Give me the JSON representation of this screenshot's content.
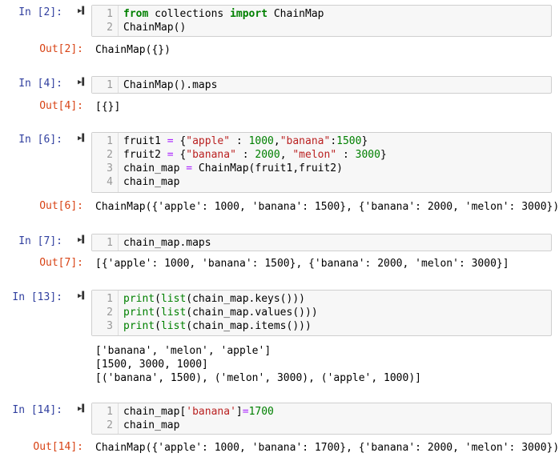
{
  "run_icon": "run-cell-icon",
  "cells": [
    {
      "in_prompt": "In [2]:",
      "lines": [
        [
          {
            "t": "from",
            "c": "kw"
          },
          {
            "t": " collections ",
            "c": ""
          },
          {
            "t": "import",
            "c": "kw"
          },
          {
            "t": " ChainMap",
            "c": ""
          }
        ],
        [
          {
            "t": "ChainMap()",
            "c": ""
          }
        ]
      ],
      "out_prompt": "Out[2]:",
      "output": "ChainMap({})"
    },
    {
      "in_prompt": "In [4]:",
      "lines": [
        [
          {
            "t": "ChainMap().maps",
            "c": ""
          }
        ]
      ],
      "out_prompt": "Out[4]:",
      "output": "[{}]"
    },
    {
      "in_prompt": "In [6]:",
      "lines": [
        [
          {
            "t": "fruit1 ",
            "c": ""
          },
          {
            "t": "=",
            "c": "op"
          },
          {
            "t": " {",
            "c": ""
          },
          {
            "t": "\"apple\"",
            "c": "str"
          },
          {
            "t": " : ",
            "c": ""
          },
          {
            "t": "1000",
            "c": "num"
          },
          {
            "t": ",",
            "c": ""
          },
          {
            "t": "\"banana\"",
            "c": "str"
          },
          {
            "t": ":",
            "c": ""
          },
          {
            "t": "1500",
            "c": "num"
          },
          {
            "t": "}",
            "c": ""
          }
        ],
        [
          {
            "t": "fruit2 ",
            "c": ""
          },
          {
            "t": "=",
            "c": "op"
          },
          {
            "t": " {",
            "c": ""
          },
          {
            "t": "\"banana\"",
            "c": "str"
          },
          {
            "t": " : ",
            "c": ""
          },
          {
            "t": "2000",
            "c": "num"
          },
          {
            "t": ", ",
            "c": ""
          },
          {
            "t": "\"melon\"",
            "c": "str"
          },
          {
            "t": " : ",
            "c": ""
          },
          {
            "t": "3000",
            "c": "num"
          },
          {
            "t": "}",
            "c": ""
          }
        ],
        [
          {
            "t": "chain_map ",
            "c": ""
          },
          {
            "t": "=",
            "c": "op"
          },
          {
            "t": " ChainMap(fruit1,fruit2)",
            "c": ""
          }
        ],
        [
          {
            "t": "chain_map",
            "c": ""
          }
        ]
      ],
      "out_prompt": "Out[6]:",
      "output": "ChainMap({'apple': 1000, 'banana': 1500}, {'banana': 2000, 'melon': 3000})"
    },
    {
      "in_prompt": "In [7]:",
      "lines": [
        [
          {
            "t": "chain_map.maps",
            "c": ""
          }
        ]
      ],
      "out_prompt": "Out[7]:",
      "output": "[{'apple': 1000, 'banana': 1500}, {'banana': 2000, 'melon': 3000}]"
    },
    {
      "in_prompt": "In [13]:",
      "lines": [
        [
          {
            "t": "print",
            "c": "num"
          },
          {
            "t": "(",
            "c": ""
          },
          {
            "t": "list",
            "c": "num"
          },
          {
            "t": "(chain_map.keys()))",
            "c": ""
          }
        ],
        [
          {
            "t": "print",
            "c": "num"
          },
          {
            "t": "(",
            "c": ""
          },
          {
            "t": "list",
            "c": "num"
          },
          {
            "t": "(chain_map.values()))",
            "c": ""
          }
        ],
        [
          {
            "t": "print",
            "c": "num"
          },
          {
            "t": "(",
            "c": ""
          },
          {
            "t": "list",
            "c": "num"
          },
          {
            "t": "(chain_map.items()))",
            "c": ""
          }
        ]
      ],
      "out_prompt": "",
      "output": "['banana', 'melon', 'apple']\n[1500, 3000, 1000]\n[('banana', 1500), ('melon', 3000), ('apple', 1000)]"
    },
    {
      "in_prompt": "In [14]:",
      "lines": [
        [
          {
            "t": "chain_map[",
            "c": ""
          },
          {
            "t": "'banana'",
            "c": "str"
          },
          {
            "t": "]",
            "c": ""
          },
          {
            "t": "=",
            "c": "op"
          },
          {
            "t": "1700",
            "c": "num"
          }
        ],
        [
          {
            "t": "chain_map",
            "c": ""
          }
        ]
      ],
      "out_prompt": "Out[14]:",
      "output": "ChainMap({'apple': 1000, 'banana': 1700}, {'banana': 2000, 'melon': 3000})"
    }
  ]
}
